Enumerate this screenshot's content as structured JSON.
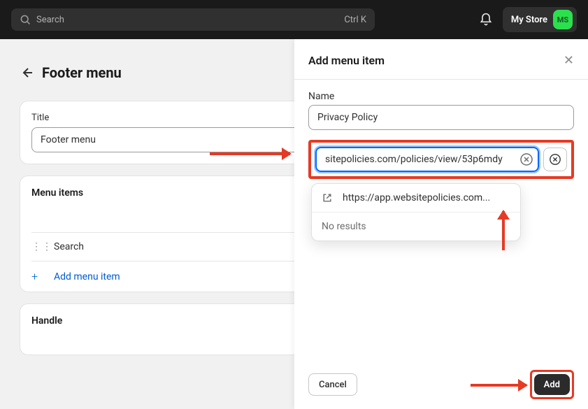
{
  "top": {
    "search_placeholder": "Search",
    "shortcut": "Ctrl K",
    "store_name": "My Store",
    "avatar_initials": "MS"
  },
  "page": {
    "title": "Footer menu"
  },
  "title_card": {
    "label": "Title",
    "value": "Footer menu"
  },
  "menu_items": {
    "heading": "Menu items",
    "items": [
      {
        "label": "Search"
      }
    ],
    "add_label": "Add menu item"
  },
  "handle_card": {
    "heading": "Handle"
  },
  "panel": {
    "title": "Add menu item",
    "name_label": "Name",
    "name_value": "Privacy Policy",
    "link_value": "sitepolicies.com/policies/view/53p6mdy",
    "suggestion": "https://app.websitepolicies.com...",
    "no_results": "No results",
    "cancel": "Cancel",
    "add": "Add"
  }
}
